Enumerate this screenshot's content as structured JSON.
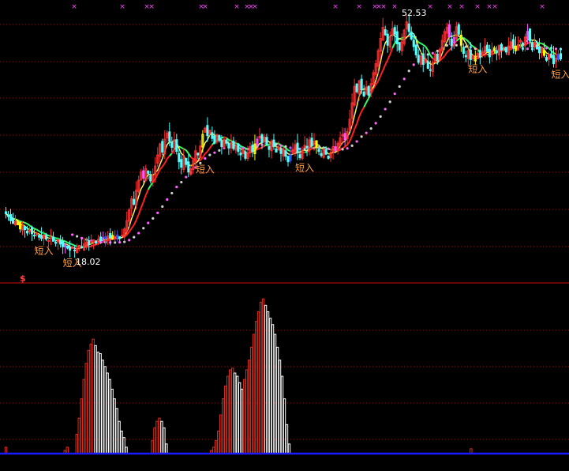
{
  "chart_data": [
    {
      "panel": "price",
      "type": "candlestick",
      "ylim": [
        16.0,
        54.5
      ],
      "price_labels": {
        "high": "52.53",
        "low": "18.02"
      },
      "signal_text": "短入",
      "signal_markers": [
        {
          "label": "短入",
          "x": 16
        },
        {
          "label": "短入",
          "x": 28
        },
        {
          "label": "短入",
          "x": 84
        },
        {
          "label": "短入",
          "x": 126
        },
        {
          "label": "短入",
          "x": 199
        },
        {
          "label": "短入",
          "x": 245
        }
      ],
      "top_marker_glyph": "×",
      "colors": {
        "up": "#ff3030",
        "down": "#54ffff",
        "ma_fast": "#ffffff",
        "ma_mid": "#ffff00",
        "ma_slow": "#d0d0d0",
        "ma_dots": "#ff66ff",
        "signal": "#ffa040"
      },
      "close": [
        24.0,
        23.6,
        23.0,
        22.6,
        22.9,
        22.4,
        21.8,
        22.3,
        21.7,
        21.2,
        21.6,
        21.1,
        20.8,
        21.2,
        20.6,
        20.4,
        20.9,
        20.3,
        20.1,
        20.5,
        20.0,
        19.7,
        20.2,
        19.6,
        19.2,
        19.5,
        19.0,
        18.7,
        19.1,
        18.6,
        19.0,
        19.4,
        19.1,
        19.6,
        19.9,
        19.5,
        20.0,
        20.2,
        19.8,
        20.3,
        20.1,
        20.5,
        20.4,
        20.8,
        20.6,
        20.3,
        20.7,
        20.5,
        20.4,
        20.9,
        21.8,
        23.0,
        24.6,
        26.2,
        25.4,
        27.5,
        28.9,
        30.1,
        29.2,
        30.6,
        29.9,
        28.8,
        29.6,
        31.0,
        32.6,
        34.2,
        33.0,
        34.9,
        35.8,
        34.6,
        33.7,
        34.8,
        33.1,
        31.6,
        30.8,
        32.3,
        31.2,
        30.1,
        30.6,
        31.8,
        33.2,
        32.6,
        33.9,
        35.6,
        36.5,
        35.4,
        36.2,
        35.0,
        34.3,
        35.6,
        34.7,
        33.8,
        34.9,
        34.3,
        33.6,
        34.4,
        33.5,
        33.9,
        33.1,
        32.6,
        33.4,
        32.1,
        32.9,
        33.8,
        33.1,
        34.2,
        34.9,
        35.3,
        34.4,
        35.2,
        34.1,
        33.4,
        34.6,
        33.8,
        33.0,
        33.7,
        32.8,
        33.5,
        32.4,
        31.6,
        32.6,
        33.4,
        34.1,
        32.9,
        32.2,
        33.3,
        34.0,
        33.6,
        34.8,
        33.9,
        34.6,
        33.7,
        33.1,
        32.5,
        33.4,
        32.7,
        32.1,
        33.0,
        33.8,
        33.2,
        34.3,
        35.1,
        35.6,
        34.8,
        36.0,
        37.8,
        40.2,
        42.6,
        41.8,
        43.4,
        42.1,
        41.2,
        42.5,
        41.3,
        43.0,
        44.6,
        45.9,
        47.8,
        49.6,
        51.2,
        50.1,
        48.6,
        49.9,
        51.0,
        50.2,
        48.8,
        47.9,
        49.1,
        50.8,
        52.0,
        50.6,
        49.5,
        48.4,
        47.2,
        46.1,
        47.0,
        45.8,
        46.6,
        45.2,
        44.9,
        46.1,
        47.3,
        46.4,
        48.0,
        49.3,
        50.6,
        51.2,
        49.8,
        48.6,
        49.7,
        51.3,
        50.2,
        48.7,
        47.4,
        46.9,
        47.8,
        46.5,
        47.1,
        46.3,
        47.4,
        46.8,
        47.6,
        48.4,
        47.7,
        46.9,
        47.8,
        48.2,
        47.5,
        48.6,
        47.9,
        48.3,
        47.6,
        48.5,
        49.1,
        48.4,
        47.8,
        48.7,
        49.3,
        48.6,
        49.8,
        50.6,
        49.2,
        48.3,
        49.0,
        48.1,
        47.5,
        48.2,
        47.1,
        46.4,
        47.3,
        46.8,
        45.9,
        46.7,
        47.2,
        46.6
      ]
    },
    {
      "panel": "indicator",
      "type": "bar",
      "ylim": [
        0,
        100
      ],
      "axis_mark": "$",
      "colors": {
        "rising": "#e02a1a",
        "falling": "#ffffff",
        "baseline": "#1a1aff"
      },
      "values": [
        4,
        0,
        0,
        0,
        0,
        0,
        0,
        0,
        0,
        0,
        0,
        0,
        0,
        0,
        0,
        0,
        0,
        0,
        0,
        0,
        0,
        0,
        0,
        0,
        0,
        2,
        4,
        0,
        0,
        0,
        12,
        22,
        34,
        46,
        56,
        64,
        68,
        71,
        67,
        63,
        62,
        58,
        54,
        50,
        46,
        40,
        34,
        28,
        20,
        14,
        10,
        4,
        0,
        0,
        0,
        0,
        0,
        0,
        0,
        0,
        0,
        0,
        8,
        16,
        20,
        22,
        20,
        16,
        6,
        0,
        0,
        0,
        0,
        0,
        0,
        0,
        0,
        0,
        0,
        0,
        0,
        0,
        0,
        0,
        0,
        0,
        0,
        2,
        4,
        8,
        14,
        24,
        34,
        42,
        48,
        52,
        53,
        50,
        48,
        44,
        40,
        46,
        52,
        58,
        66,
        74,
        82,
        88,
        94,
        96,
        92,
        88,
        84,
        80,
        74,
        66,
        58,
        48,
        34,
        18,
        6,
        0,
        0,
        0,
        0,
        0,
        0,
        0,
        0,
        0,
        0,
        0,
        0,
        0,
        0,
        0,
        0,
        0,
        0,
        0,
        0,
        0,
        0,
        0,
        0,
        0,
        0,
        0,
        0,
        0,
        0,
        0,
        0,
        0,
        0,
        0,
        0,
        0,
        0,
        0,
        0,
        0,
        0,
        0,
        0,
        0,
        0,
        0,
        0,
        0,
        0,
        0,
        0,
        0,
        0,
        0,
        0,
        0,
        0,
        0,
        0,
        0,
        0,
        0,
        0,
        0,
        0,
        0,
        0,
        0,
        0,
        0,
        0,
        0,
        0,
        0,
        0,
        3,
        0,
        0,
        0,
        0,
        0,
        0,
        0,
        0,
        0,
        0,
        0,
        0,
        0,
        0,
        0,
        0,
        0,
        0,
        0,
        0,
        0,
        0,
        0,
        0,
        0,
        0,
        0,
        0,
        0,
        0,
        0,
        0,
        0,
        0,
        0,
        0,
        0,
        0
      ]
    }
  ]
}
